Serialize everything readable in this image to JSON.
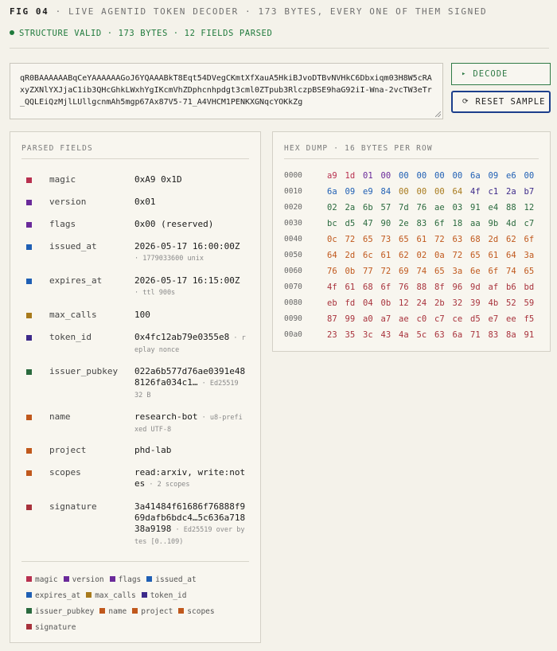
{
  "header": {
    "fig": "FIG 04",
    "title": "· LIVE AGENTID TOKEN DECODER · 173 BYTES, EVERY ONE OF THEM SIGNED"
  },
  "status": {
    "text": "STRUCTURE VALID · 173 BYTES · 12 FIELDS PARSED",
    "color": "#1f7a3c"
  },
  "token": {
    "value": "qR0BAAAAAABqCeYAAAAAAGoJ6YQAAABkT8Eqt54DVegCKmtXfXauA5HkiBJvoDTBvNVHkC6Dbxiqm03H8W5cRAxyZXNlYXJjaC1ib3QHcGhkLWxhYgIKcmVhZDphcnhpdgt3cml0ZTpub3RlczpBSE9haG92iI-Wna-2vcTW3eTr_QQLEiQzMjlLUllgcnmAh5mgp67Ax87V5-71_A4VHCM1PENKXGNqcYOKkZg"
  },
  "buttons": {
    "decode_icon": "▸",
    "decode": "DECODE",
    "reset_icon": "⟳",
    "reset": "RESET SAMPLE"
  },
  "left_panel": {
    "title": "PARSED FIELDS"
  },
  "right_panel": {
    "title": "HEX DUMP · 16 BYTES PER ROW"
  },
  "colors": {
    "magic": "#b8304f",
    "version": "#6a2a9a",
    "flags": "#6a2a9a",
    "issued_at": "#1f5fb4",
    "expires_at": "#1f5fb4",
    "max_calls": "#a87a1c",
    "token_id": "#3d2a8a",
    "issuer_pubkey": "#2a6a3e",
    "name": "#c0581c",
    "project": "#c0581c",
    "scopes": "#c0581c",
    "signature": "#a8323c"
  },
  "fields": [
    {
      "key": "magic",
      "name": "magic",
      "value": "0xA9 0x1D",
      "note": "",
      "sub": ""
    },
    {
      "key": "version",
      "name": "version",
      "value": "0x01",
      "note": "",
      "sub": ""
    },
    {
      "key": "flags",
      "name": "flags",
      "value": "0x00 (reserved)",
      "note": "",
      "sub": ""
    },
    {
      "key": "issued_at",
      "name": "issued_at",
      "value": "2026-05-17 16:00:00Z",
      "note": "",
      "sub": "· 1779033600 unix"
    },
    {
      "key": "expires_at",
      "name": "expires_at",
      "value": "2026-05-17 16:15:00Z",
      "note": "",
      "sub": "· ttl 900s"
    },
    {
      "key": "max_calls",
      "name": "max_calls",
      "value": "100",
      "note": "",
      "sub": ""
    },
    {
      "key": "token_id",
      "name": "token_id",
      "value": "0x4fc12ab79e0355e8",
      "note": " · replay nonce",
      "sub": ""
    },
    {
      "key": "issuer_pubkey",
      "name": "issuer_pubkey",
      "value": "022a6b577d76ae0391e488126fa034c1…",
      "note": " · Ed25519 32 B",
      "sub": ""
    },
    {
      "key": "name",
      "name": "name",
      "value": "research-bot",
      "note": " · u8-prefixed UTF-8",
      "sub": ""
    },
    {
      "key": "project",
      "name": "project",
      "value": "phd-lab",
      "note": "",
      "sub": ""
    },
    {
      "key": "scopes",
      "name": "scopes",
      "value": "read:arxiv, write:notes",
      "note": " · 2 scopes",
      "sub": ""
    },
    {
      "key": "signature",
      "name": "signature",
      "value": "3a41484f61686f76888f969dafb6bdc4…5c636a71838a9198",
      "note": " · Ed25519 over bytes [0..109)",
      "sub": ""
    }
  ],
  "legend": [
    {
      "key": "magic",
      "label": "magic"
    },
    {
      "key": "version",
      "label": "version"
    },
    {
      "key": "flags",
      "label": "flags"
    },
    {
      "key": "issued_at",
      "label": "issued_at"
    },
    {
      "key": "expires_at",
      "label": "expires_at"
    },
    {
      "key": "max_calls",
      "label": "max_calls"
    },
    {
      "key": "token_id",
      "label": "token_id"
    },
    {
      "key": "issuer_pubkey",
      "label": "issuer_pubkey"
    },
    {
      "key": "name",
      "label": "name"
    },
    {
      "key": "project",
      "label": "project"
    },
    {
      "key": "scopes",
      "label": "scopes"
    },
    {
      "key": "signature",
      "label": "signature"
    }
  ],
  "hex_rows": [
    {
      "offset": "0000",
      "bytes": [
        "a9",
        "1d",
        "01",
        "00",
        "00",
        "00",
        "00",
        "00",
        "6a",
        "09",
        "e6",
        "00"
      ],
      "keys": [
        "magic",
        "magic",
        "version",
        "flags",
        "issued_at",
        "issued_at",
        "issued_at",
        "issued_at",
        "issued_at",
        "issued_at",
        "issued_at",
        "expires_at"
      ]
    },
    {
      "offset": "0010",
      "bytes": [
        "6a",
        "09",
        "e9",
        "84",
        "00",
        "00",
        "00",
        "64",
        "4f",
        "c1",
        "2a",
        "b7"
      ],
      "keys": [
        "expires_at",
        "expires_at",
        "expires_at",
        "expires_at",
        "max_calls",
        "max_calls",
        "max_calls",
        "max_calls",
        "token_id",
        "token_id",
        "token_id",
        "token_id"
      ]
    },
    {
      "offset": "0020",
      "bytes": [
        "02",
        "2a",
        "6b",
        "57",
        "7d",
        "76",
        "ae",
        "03",
        "91",
        "e4",
        "88",
        "12"
      ],
      "keys": [
        "issuer_pubkey",
        "issuer_pubkey",
        "issuer_pubkey",
        "issuer_pubkey",
        "issuer_pubkey",
        "issuer_pubkey",
        "issuer_pubkey",
        "issuer_pubkey",
        "issuer_pubkey",
        "issuer_pubkey",
        "issuer_pubkey",
        "issuer_pubkey"
      ]
    },
    {
      "offset": "0030",
      "bytes": [
        "bc",
        "d5",
        "47",
        "90",
        "2e",
        "83",
        "6f",
        "18",
        "aa",
        "9b",
        "4d",
        "c7"
      ],
      "keys": [
        "issuer_pubkey",
        "issuer_pubkey",
        "issuer_pubkey",
        "issuer_pubkey",
        "issuer_pubkey",
        "issuer_pubkey",
        "issuer_pubkey",
        "issuer_pubkey",
        "issuer_pubkey",
        "issuer_pubkey",
        "issuer_pubkey",
        "issuer_pubkey"
      ]
    },
    {
      "offset": "0040",
      "bytes": [
        "0c",
        "72",
        "65",
        "73",
        "65",
        "61",
        "72",
        "63",
        "68",
        "2d",
        "62",
        "6f"
      ],
      "keys": [
        "name",
        "name",
        "name",
        "name",
        "name",
        "name",
        "name",
        "name",
        "name",
        "name",
        "name",
        "name"
      ]
    },
    {
      "offset": "0050",
      "bytes": [
        "64",
        "2d",
        "6c",
        "61",
        "62",
        "02",
        "0a",
        "72",
        "65",
        "61",
        "64",
        "3a"
      ],
      "keys": [
        "project",
        "project",
        "project",
        "project",
        "project",
        "scopes",
        "scopes",
        "scopes",
        "scopes",
        "scopes",
        "scopes",
        "scopes"
      ]
    },
    {
      "offset": "0060",
      "bytes": [
        "76",
        "0b",
        "77",
        "72",
        "69",
        "74",
        "65",
        "3a",
        "6e",
        "6f",
        "74",
        "65"
      ],
      "keys": [
        "scopes",
        "scopes",
        "scopes",
        "scopes",
        "scopes",
        "scopes",
        "scopes",
        "scopes",
        "scopes",
        "scopes",
        "scopes",
        "scopes"
      ]
    },
    {
      "offset": "0070",
      "bytes": [
        "4f",
        "61",
        "68",
        "6f",
        "76",
        "88",
        "8f",
        "96",
        "9d",
        "af",
        "b6",
        "bd"
      ],
      "keys": [
        "signature",
        "signature",
        "signature",
        "signature",
        "signature",
        "signature",
        "signature",
        "signature",
        "signature",
        "signature",
        "signature",
        "signature"
      ]
    },
    {
      "offset": "0080",
      "bytes": [
        "eb",
        "fd",
        "04",
        "0b",
        "12",
        "24",
        "2b",
        "32",
        "39",
        "4b",
        "52",
        "59"
      ],
      "keys": [
        "signature",
        "signature",
        "signature",
        "signature",
        "signature",
        "signature",
        "signature",
        "signature",
        "signature",
        "signature",
        "signature",
        "signature"
      ]
    },
    {
      "offset": "0090",
      "bytes": [
        "87",
        "99",
        "a0",
        "a7",
        "ae",
        "c0",
        "c7",
        "ce",
        "d5",
        "e7",
        "ee",
        "f5"
      ],
      "keys": [
        "signature",
        "signature",
        "signature",
        "signature",
        "signature",
        "signature",
        "signature",
        "signature",
        "signature",
        "signature",
        "signature",
        "signature"
      ]
    },
    {
      "offset": "00a0",
      "bytes": [
        "23",
        "35",
        "3c",
        "43",
        "4a",
        "5c",
        "63",
        "6a",
        "71",
        "83",
        "8a",
        "91"
      ],
      "keys": [
        "signature",
        "signature",
        "signature",
        "signature",
        "signature",
        "signature",
        "signature",
        "signature",
        "signature",
        "signature",
        "signature",
        "signature"
      ]
    }
  ]
}
